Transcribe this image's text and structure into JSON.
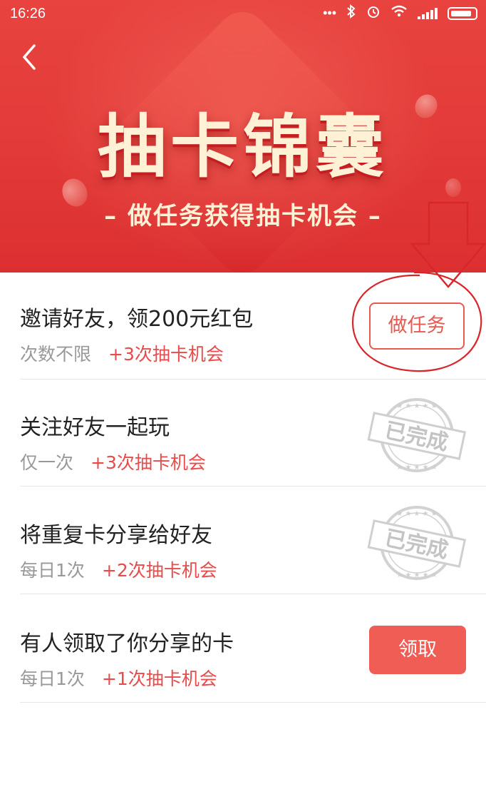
{
  "status_bar": {
    "time": "16:26"
  },
  "header": {
    "title": "抽卡锦囊",
    "subtitle": "– 做任务获得抽卡机会 –"
  },
  "tasks": [
    {
      "name": "邀请好友，领200元红包",
      "limit": "次数不限",
      "reward": "+3次抽卡机会",
      "action": "button-outline",
      "action_label": "做任务"
    },
    {
      "name": "关注好友一起玩",
      "limit": "仅一次",
      "reward": "+3次抽卡机会",
      "action": "stamp",
      "action_label": "已完成"
    },
    {
      "name": "将重复卡分享给好友",
      "limit": "每日1次",
      "reward": "+2次抽卡机会",
      "action": "stamp",
      "action_label": "已完成"
    },
    {
      "name": "有人领取了你分享的卡",
      "limit": "每日1次",
      "reward": "+1次抽卡机会",
      "action": "button-solid",
      "action_label": "领取"
    }
  ],
  "colors": {
    "banner_red": "#e23a38",
    "accent_red": "#e8594f",
    "button_red": "#f05d55",
    "title_cream": "#fff1d6",
    "stamp_gray": "#c9c9c9"
  }
}
